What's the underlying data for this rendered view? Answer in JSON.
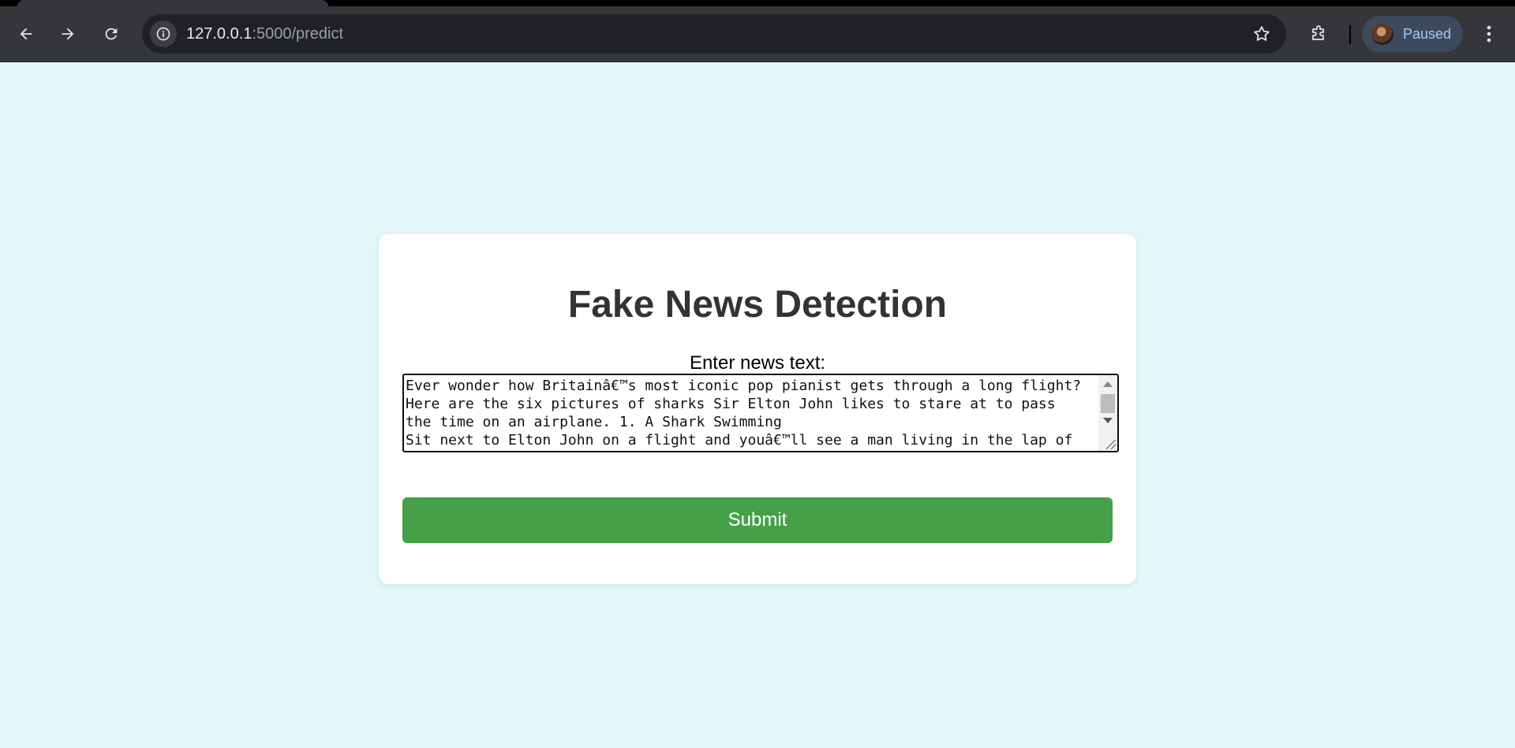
{
  "browser": {
    "url_host": "127.0.0.1",
    "url_path": ":5000/predict",
    "profile_status": "Paused"
  },
  "page": {
    "title": "Fake News Detection",
    "input_label": "Enter news text:",
    "news_text_lines": [
      "Ever wonder how Britainâ€™s most iconic pop pianist gets through a long flight?",
      "Here are the six pictures of sharks Sir Elton John likes to stare at to pass",
      "the time on an airplane. 1. A Shark Swimming",
      "Sit next to Elton John on a flight and youâ€™ll see a man living in the lap of"
    ],
    "submit_label": "Submit"
  }
}
